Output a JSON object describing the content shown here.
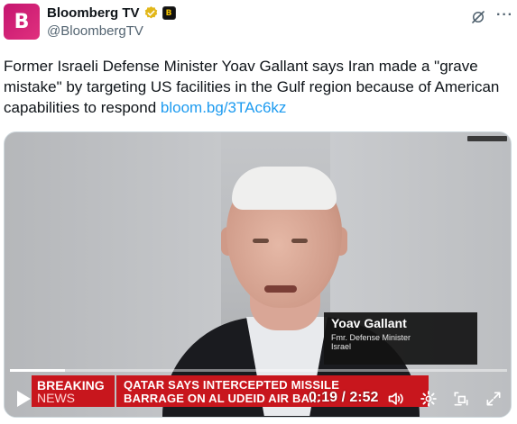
{
  "account": {
    "display_name": "Bloomberg TV",
    "handle": "@BloombergTV",
    "avatar_letter": "B",
    "affiliate_badge_letter": "B",
    "verified_color": "#e2b719",
    "avatar_color": "#d01a72"
  },
  "tweet": {
    "text": "Former Israeli Defense Minister Yoav Gallant says Iran made a \"grave mistake\" by targeting US facilities in the Gulf region because of American capabilities to respond ",
    "link": "bloom.bg/3TAc6kz",
    "link_color": "#1d9bf0"
  },
  "video": {
    "lower_third": {
      "name": "Yoav Gallant",
      "title_line1": "Fmr. Defense Minister",
      "title_line2": "Israel"
    },
    "ticker": {
      "label_line1": "BREAKING",
      "label_line2": "NEWS",
      "headline_line1": "QATAR SAYS INTERCEPTED MISSILE",
      "headline_line2": "BARRAGE ON AL UDEID AIR BA..."
    },
    "player": {
      "current_time": "0:19",
      "duration": "2:52",
      "time_display": "0:19 / 2:52",
      "progress_fraction": 0.11
    }
  },
  "icons": {
    "grok": "grok-icon",
    "more": "more-icon",
    "play": "play-icon",
    "volume": "volume-icon",
    "settings": "gear-icon",
    "pip": "picture-in-picture-icon",
    "fullscreen": "fullscreen-icon"
  }
}
